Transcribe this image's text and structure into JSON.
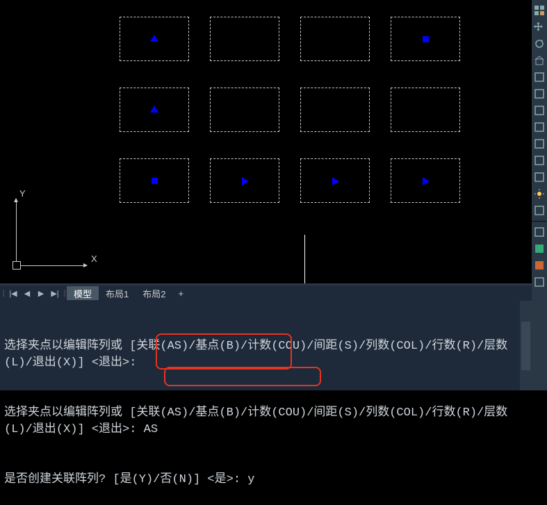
{
  "ucs": {
    "x_label": "X",
    "y_label": "Y"
  },
  "tabs": {
    "model": "模型",
    "layout1": "布局1",
    "layout2": "布局2",
    "plus": "+"
  },
  "nav": {
    "first": "|◀",
    "prev": "◀",
    "next": "▶",
    "last": "▶|",
    "sep": "|"
  },
  "command": {
    "line1": "选择夹点以编辑阵列或 [关联(AS)/基点(B)/计数(COU)/间距(S)/列数(COL)/行数(R)/层数(L)/退出(X)] <退出>:",
    "line2": "选择夹点以编辑阵列或 [关联(AS)/基点(B)/计数(COU)/间距(S)/列数(COL)/行数(R)/层数(L)/退出(X)] <退出>: AS",
    "line3": "是否创建关联阵列? [是(Y)/否(N)] <是>: y"
  },
  "grid": {
    "cols": [
      172,
      302,
      432,
      562
    ],
    "rows": [
      24,
      126,
      228
    ],
    "markers": [
      {
        "r": 0,
        "c": 0,
        "type": "tri-up"
      },
      {
        "r": 0,
        "c": 3,
        "type": "sq"
      },
      {
        "r": 1,
        "c": 0,
        "type": "tri-up"
      },
      {
        "r": 2,
        "c": 0,
        "type": "sq"
      },
      {
        "r": 2,
        "c": 1,
        "type": "tri-right"
      },
      {
        "r": 2,
        "c": 2,
        "type": "tri-right"
      },
      {
        "r": 2,
        "c": 3,
        "type": "tri-right"
      }
    ]
  },
  "right_icons": [
    "grid-icon",
    "pan-icon",
    "orbit-icon",
    "home-icon",
    "layers-icon",
    "extent-icon",
    "box-icon",
    "snap-icon",
    "measure-icon",
    "edit-icon",
    "face-icon",
    "light-icon",
    "mesh-icon",
    "sep",
    "clip-icon",
    "swatch-icon",
    "swatch2-icon",
    "more-icon"
  ]
}
